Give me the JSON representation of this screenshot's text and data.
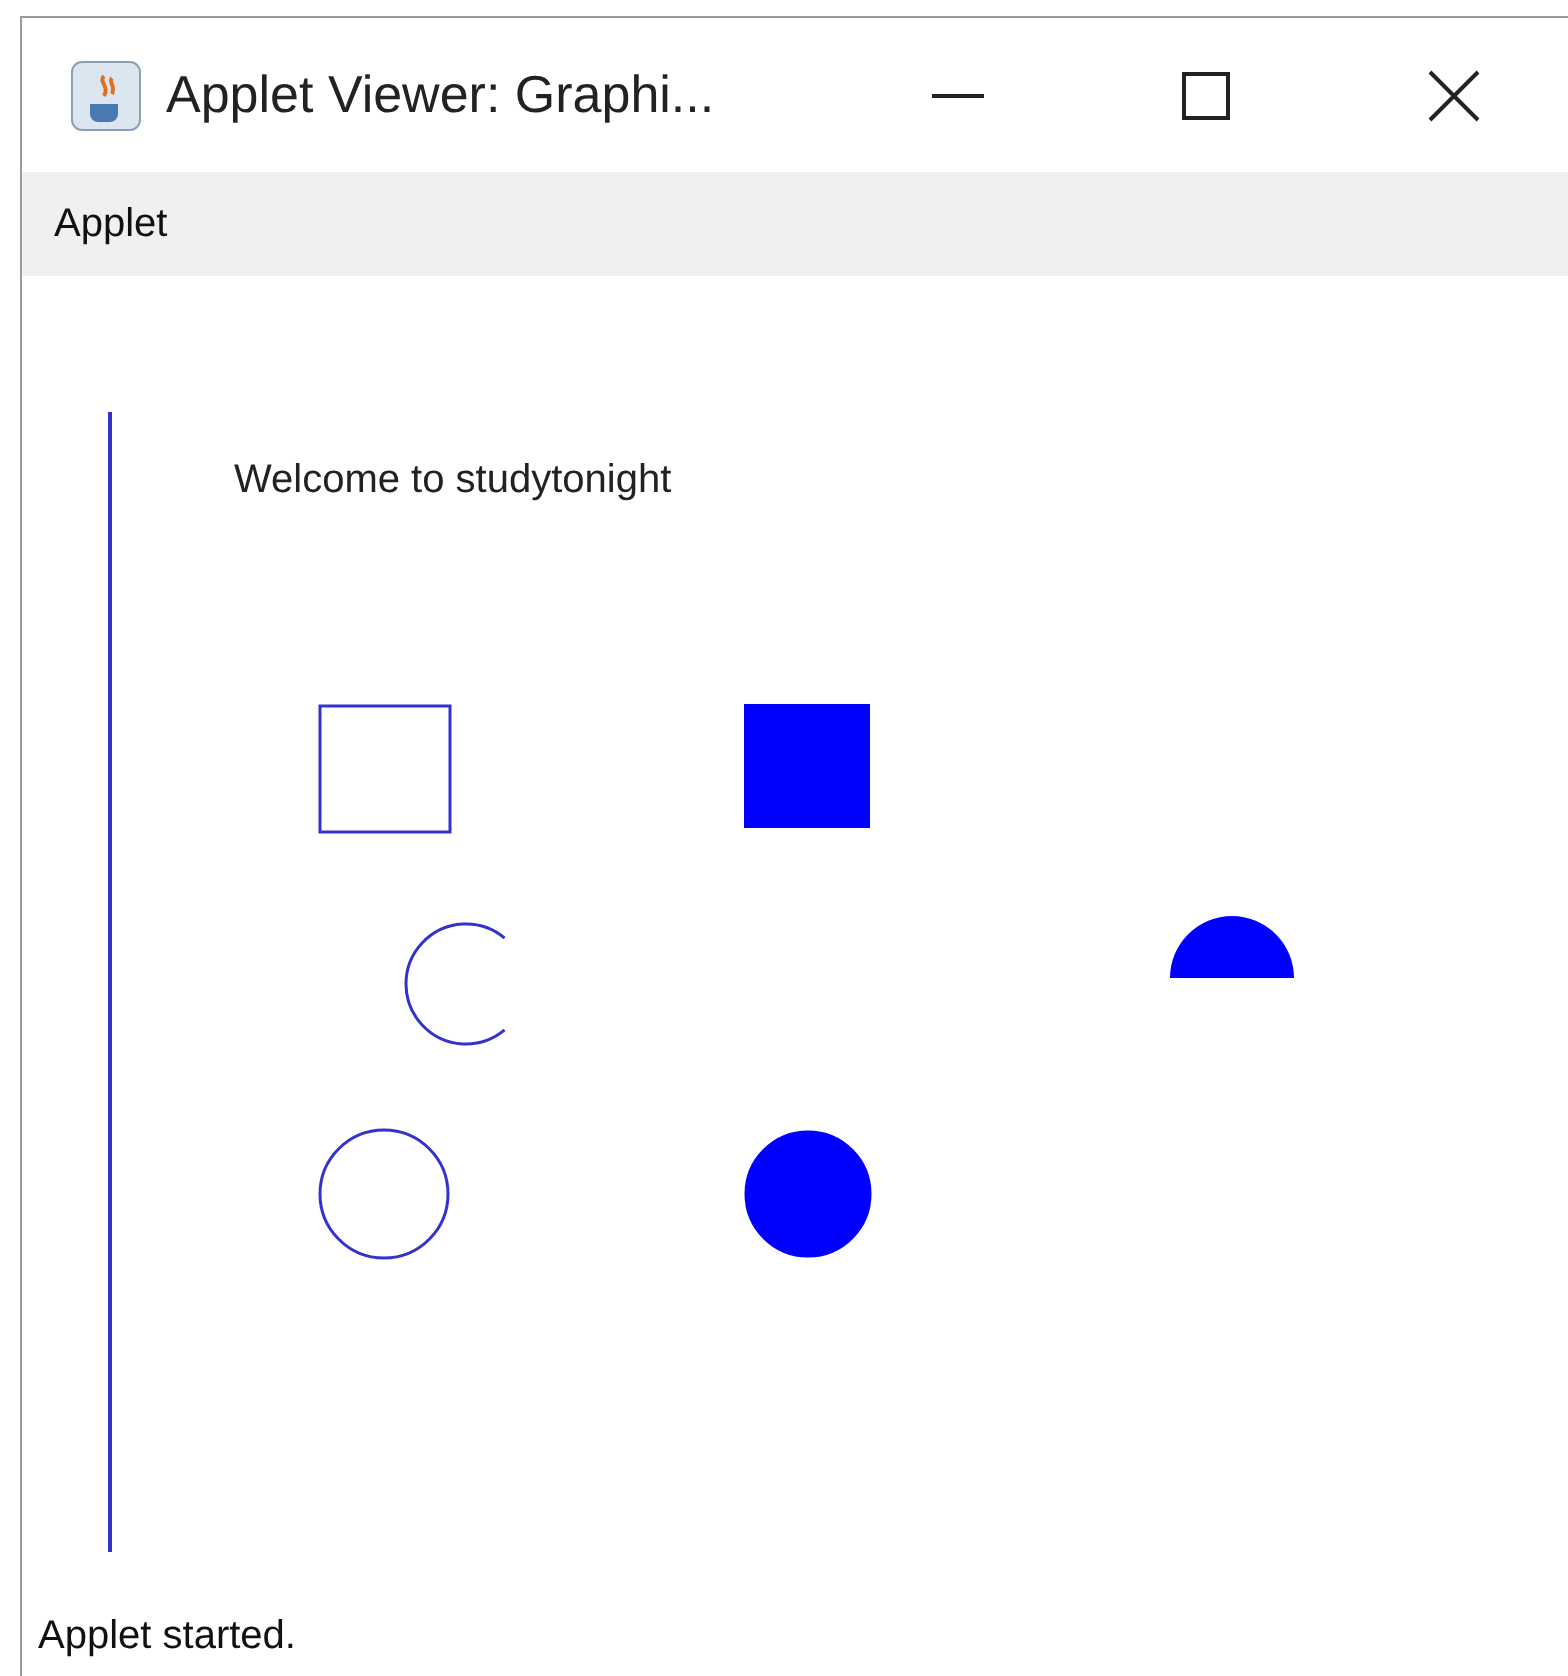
{
  "window": {
    "title": "Applet Viewer: Graphi..."
  },
  "menu_bar": {
    "items": [
      "Applet"
    ]
  },
  "canvas": {
    "text": "Welcome to studytonight",
    "shapes": [
      {
        "kind": "line"
      },
      {
        "kind": "rect",
        "filled": false
      },
      {
        "kind": "rect",
        "filled": true
      },
      {
        "kind": "arc",
        "filled": false
      },
      {
        "kind": "arc",
        "filled": true
      },
      {
        "kind": "oval",
        "filled": false
      },
      {
        "kind": "oval",
        "filled": true
      }
    ]
  },
  "status_bar": {
    "text": "Applet started."
  }
}
